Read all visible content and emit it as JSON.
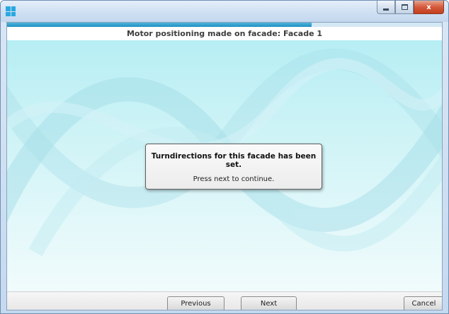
{
  "window": {
    "title_icon": "app-grid-icon",
    "controls": {
      "minimize_icon": "minimize-icon",
      "maximize_icon": "maximize-icon",
      "close_label": "x"
    }
  },
  "wizard": {
    "progress_fraction": 0.7,
    "header_title": "Motor positioning made on facade: Facade 1"
  },
  "message": {
    "title": "Turndirections for this facade has been set.",
    "body": "Press next to continue."
  },
  "buttons": {
    "previous": "Previous",
    "next": "Next",
    "cancel": "Cancel"
  },
  "colors": {
    "accent": "#1f8fc2",
    "background_top": "#b6eef4",
    "close_button": "#d4593a"
  }
}
